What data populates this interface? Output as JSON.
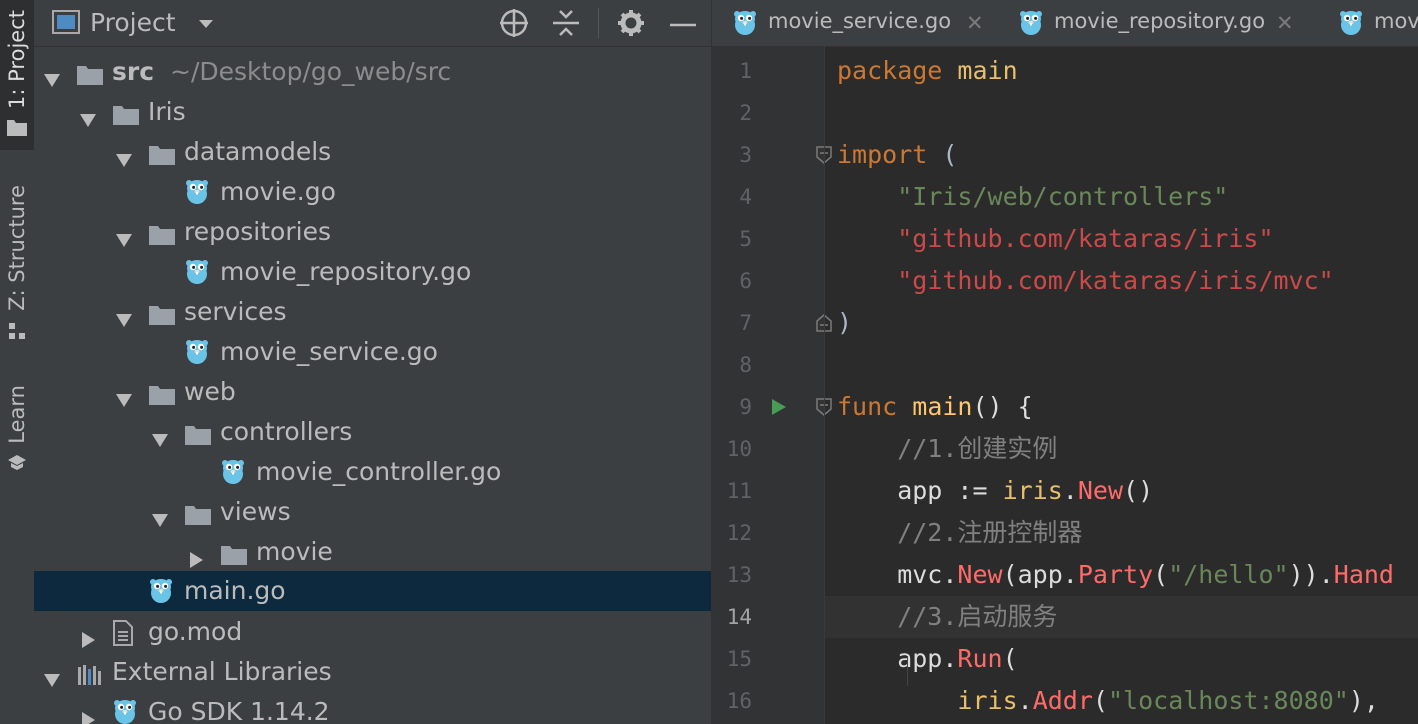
{
  "left_strip": {
    "tabs": [
      {
        "label": "1: Project",
        "active": true
      },
      {
        "label": "Z: Structure",
        "active": false
      },
      {
        "label": "Learn",
        "active": false
      }
    ]
  },
  "project_panel": {
    "title": "Project",
    "tree": [
      {
        "label": "src",
        "sub": "~/Desktop/go_web/src"
      },
      {
        "label": "Iris"
      },
      {
        "label": "datamodels"
      },
      {
        "label": "movie.go"
      },
      {
        "label": "repositories"
      },
      {
        "label": "movie_repository.go"
      },
      {
        "label": "services"
      },
      {
        "label": "movie_service.go"
      },
      {
        "label": "web"
      },
      {
        "label": "controllers"
      },
      {
        "label": "movie_controller.go"
      },
      {
        "label": "views"
      },
      {
        "label": "movie"
      },
      {
        "label": "main.go"
      },
      {
        "label": "go.mod"
      },
      {
        "label": "External Libraries"
      },
      {
        "label": "Go SDK 1.14.2"
      }
    ]
  },
  "editor": {
    "tabs": [
      {
        "label": "movie_service.go"
      },
      {
        "label": "movie_repository.go"
      },
      {
        "label": "movi"
      }
    ],
    "current_line": "14",
    "line_numbers": [
      "1",
      "2",
      "3",
      "4",
      "5",
      "6",
      "7",
      "8",
      "9",
      "10",
      "11",
      "12",
      "13",
      "14",
      "15",
      "16"
    ],
    "code": {
      "l1": {
        "a": "package",
        "b": " main"
      },
      "l3": {
        "a": "import",
        "b": " ("
      },
      "l4": {
        "a": "    ",
        "b": "\"Iris/web/controllers\""
      },
      "l5": {
        "a": "    ",
        "b": "\"github.com/kataras/iris\""
      },
      "l6": {
        "a": "    ",
        "b": "\"github.com/kataras/iris/mvc\""
      },
      "l7": {
        "a": ")"
      },
      "l9": {
        "a": "func",
        "b": " ",
        "c": "main",
        "d": "() {"
      },
      "l10": {
        "a": "    //1.创建实例"
      },
      "l11": {
        "a": "    app := ",
        "b": "iris",
        "c": ".",
        "d": "New",
        "e": "()"
      },
      "l12": {
        "a": "    //2.注册控制器"
      },
      "l13": {
        "a": "    mvc",
        "b": ".",
        "c": "New",
        "d": "(app",
        "e": ".",
        "f": "Party",
        "g": "(",
        "h": "\"/hello\"",
        "i": "))",
        "j": ".",
        "k": "Hand"
      },
      "l14": {
        "a": "    //3.启动服务"
      },
      "l15": {
        "a": "    app",
        "b": ".",
        "c": "Run",
        "d": "("
      },
      "l16": {
        "a": "        ",
        "b": "iris",
        "c": ".",
        "d": "Addr",
        "e": "(",
        "f": "\"localhost:8080\"",
        "g": "),"
      }
    }
  }
}
